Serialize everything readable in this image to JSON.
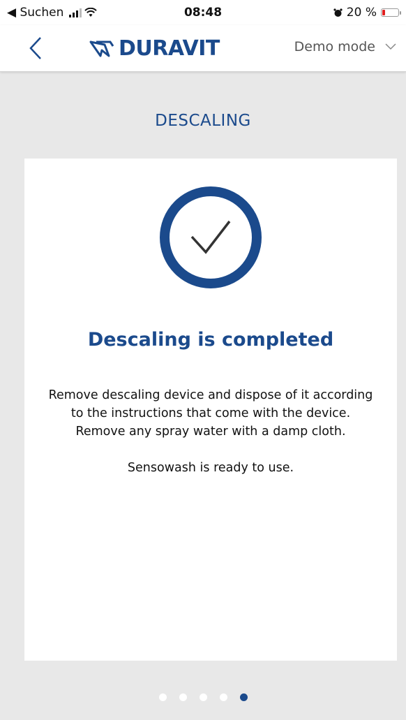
{
  "status_bar": {
    "back_to_app": "◀ Suchen",
    "time": "08:48",
    "battery_percent": "20 %",
    "battery_level": 0.2
  },
  "nav": {
    "brand": "DURAVIT",
    "mode_label": "Demo mode"
  },
  "page": {
    "title": "DESCALING"
  },
  "card": {
    "heading": "Descaling is completed",
    "lines": [
      "Remove descaling device and dispose of it according to the instructions that come with the device.",
      "Remove any spray water with a damp cloth.",
      "Sensowash is ready to use."
    ]
  },
  "pager": {
    "total": 5,
    "active_index": 4
  },
  "colors": {
    "brand_blue": "#1b4a8c",
    "background": "#e8e8e8",
    "battery_low": "#e02020"
  }
}
